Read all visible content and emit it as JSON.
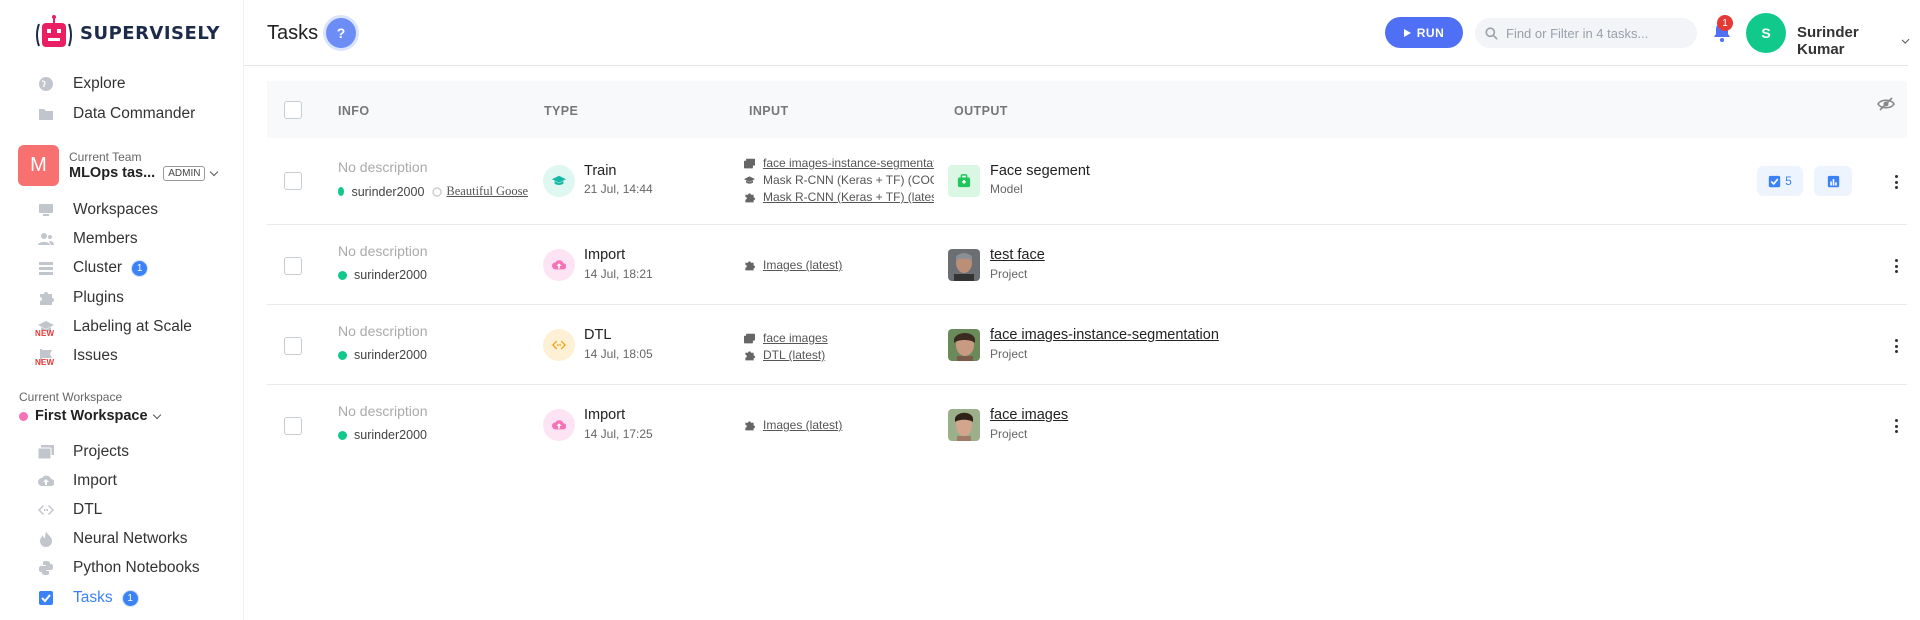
{
  "app": {
    "brand": "SUPERVISELY"
  },
  "sidebar": {
    "nav_top": [
      {
        "label": "Explore",
        "icon": "globe-icon"
      },
      {
        "label": "Data Commander",
        "icon": "folder-icon"
      }
    ],
    "team": {
      "label": "Current Team",
      "avatar": "M",
      "name": "MLOps tas...",
      "role": "ADMIN"
    },
    "nav_team": [
      {
        "label": "Workspaces",
        "icon": "monitor-icon"
      },
      {
        "label": "Members",
        "icon": "members-icon"
      },
      {
        "label": "Cluster",
        "icon": "cluster-icon",
        "count": "1"
      },
      {
        "label": "Plugins",
        "icon": "puzzle-icon"
      },
      {
        "label": "Labeling at Scale",
        "icon": "graduation-icon",
        "tag": "NEW"
      },
      {
        "label": "Issues",
        "icon": "flag-icon",
        "tag": "NEW"
      }
    ],
    "workspace": {
      "label": "Current Workspace",
      "name": "First Workspace"
    },
    "nav_workspace": [
      {
        "label": "Projects",
        "icon": "images-icon"
      },
      {
        "label": "Import",
        "icon": "cloud-upload-icon"
      },
      {
        "label": "DTL",
        "icon": "code-icon"
      },
      {
        "label": "Neural Networks",
        "icon": "flame-icon"
      },
      {
        "label": "Python Notebooks",
        "icon": "python-icon"
      },
      {
        "label": "Tasks",
        "icon": "checkbox-icon",
        "count": "1",
        "active": true
      }
    ]
  },
  "header": {
    "title": "Tasks",
    "help": "?",
    "run_label": "RUN",
    "search_placeholder": "Find or Filter in 4 tasks...",
    "notifications": "1",
    "user_initial": "S",
    "user_name": "Surinder Kumar"
  },
  "table": {
    "columns": [
      "INFO",
      "TYPE",
      "INPUT",
      "OUTPUT"
    ],
    "rows": [
      {
        "description": "No description",
        "owner": "surinder2000",
        "session": "Beautiful Goose",
        "type": "Train",
        "date": "21 Jul, 14:44",
        "inputs": [
          "face images-instance-segmentation",
          "Mask R-CNN (Keras + TF) (COCO)",
          "Mask R-CNN (Keras + TF) (latest)"
        ],
        "output_name": "Face segement",
        "output_type": "Model",
        "checks": "5"
      },
      {
        "description": "No description",
        "owner": "surinder2000",
        "type": "Import",
        "date": "14 Jul, 18:21",
        "inputs": [
          "Images (latest)"
        ],
        "output_name": "test face",
        "output_type": "Project"
      },
      {
        "description": "No description",
        "owner": "surinder2000",
        "type": "DTL",
        "date": "14 Jul, 18:05",
        "inputs": [
          "face images",
          "DTL (latest)"
        ],
        "output_name": "face images-instance-segmentation",
        "output_type": "Project"
      },
      {
        "description": "No description",
        "owner": "surinder2000",
        "type": "Import",
        "date": "14 Jul, 17:25",
        "inputs": [
          "Images (latest)"
        ],
        "output_name": "face images",
        "output_type": "Project"
      }
    ]
  },
  "colors": {
    "accent": "#3b82f6",
    "run": "#4f6ff5",
    "online": "#10c98a",
    "team_avatar": "#f87171"
  }
}
